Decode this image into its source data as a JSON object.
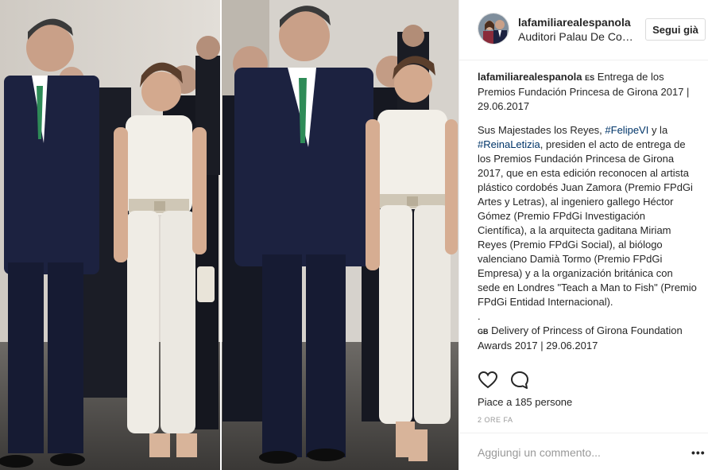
{
  "post": {
    "photo_alt": "King Felipe VI and Queen Letizia at the Premios Fundación Princesa de Girona",
    "author": {
      "username": "lafamiliarealespanola",
      "location": "Auditori Palau De Congressos"
    },
    "follow_label": "Segui già",
    "caption": {
      "flag_es": "ES",
      "title": "Entrega de los Premios Fundación Princesa de Girona 2017 | 29.06.2017",
      "body_1": "Sus Majestades los Reyes, ",
      "tag_1": "#FelipeVI",
      "body_2": " y la ",
      "tag_2": "#ReinaLetizia",
      "body_3": ", presiden el acto de entrega de los Premios Fundación Princesa de Girona 2017, que en esta edición reconocen al artista plástico cordobés Juan Zamora (Premio FPdGi Artes y Letras), al ingeniero gallego Héctor Gómez (Premio FPdGi Investigación Científica), a la arquitecta gaditana Miriam Reyes (Premio FPdGi Social), al biólogo valenciano Damià Tormo (Premio FPdGi Empresa) y a la organización británica con sede en Londres \"Teach a Man to Fish\" (Premio FPdGi Entidad Internacional).",
      "dot": ".",
      "flag_gb": "GB",
      "english": "Delivery of Princess of Girona Foundation Awards 2017 | 29.06.2017"
    },
    "likes_text": "Piace a 185 persone",
    "timestamp": "2 ORE FA",
    "comment_placeholder": "Aggiungi un commento...",
    "more_label": "•••",
    "icons": {
      "like": "heart-icon",
      "comment": "comment-bubble-icon"
    },
    "colors": {
      "hashtag": "#003569",
      "text": "#262626",
      "muted": "#999999",
      "border": "#efefef"
    }
  }
}
